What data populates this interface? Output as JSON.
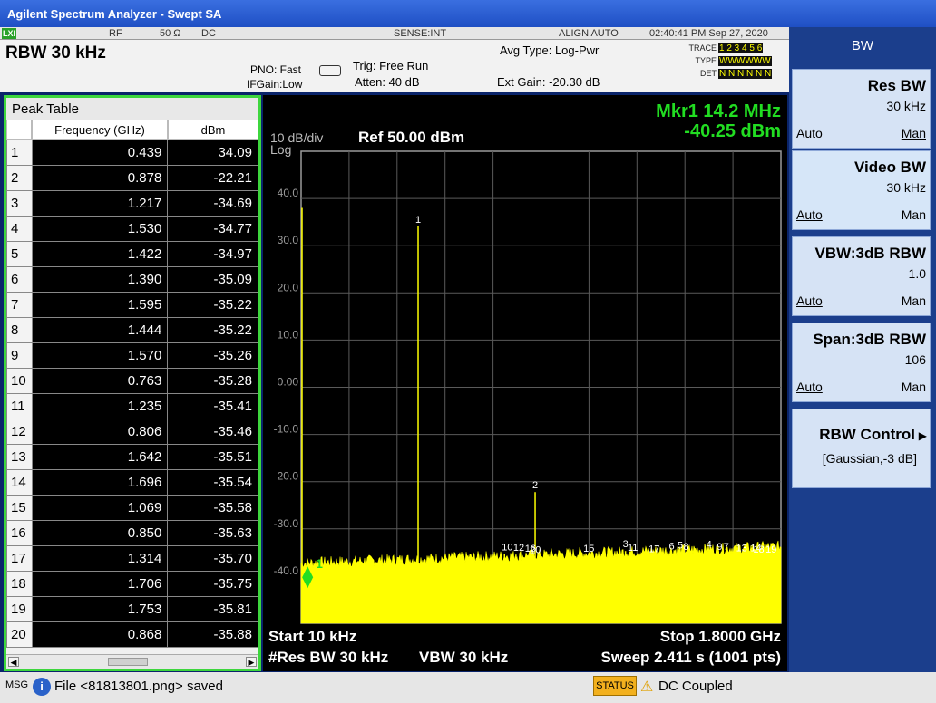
{
  "window": {
    "title": "Agilent Spectrum Analyzer - Swept SA"
  },
  "meas_bar": {
    "logo": "LXI",
    "rf": "RF",
    "impedance": "50 Ω",
    "coupling": "DC",
    "sense": "SENSE:INT",
    "align": "ALIGN AUTO",
    "datetime": "02:40:41 PM Sep 27, 2020",
    "rbw": "RBW 30 kHz",
    "pno": "PNO: Fast",
    "ifgain": "IFGain:Low",
    "trig": "Trig: Free Run",
    "atten": "Atten: 40 dB",
    "avg_type": "Avg Type: Log-Pwr",
    "ext_gain": "Ext Gain: -20.30 dB",
    "trace_label": "TRACE",
    "trace_value": "1 2 3 4 5 6",
    "type_label": "TYPE",
    "type_value": "WWWWWW",
    "det_label": "DET",
    "det_value": "N N N N N N"
  },
  "peak_table": {
    "title": "Peak Table",
    "col_freq": "Frequency (GHz)",
    "col_dbm": "dBm",
    "rows": [
      {
        "n": "1",
        "f": "0.439",
        "d": "34.09"
      },
      {
        "n": "2",
        "f": "0.878",
        "d": "-22.21"
      },
      {
        "n": "3",
        "f": "1.217",
        "d": "-34.69"
      },
      {
        "n": "4",
        "f": "1.530",
        "d": "-34.77"
      },
      {
        "n": "5",
        "f": "1.422",
        "d": "-34.97"
      },
      {
        "n": "6",
        "f": "1.390",
        "d": "-35.09"
      },
      {
        "n": "7",
        "f": "1.595",
        "d": "-35.22"
      },
      {
        "n": "8",
        "f": "1.444",
        "d": "-35.22"
      },
      {
        "n": "9",
        "f": "1.570",
        "d": "-35.26"
      },
      {
        "n": "10",
        "f": "0.763",
        "d": "-35.28"
      },
      {
        "n": "11",
        "f": "1.235",
        "d": "-35.41"
      },
      {
        "n": "12",
        "f": "0.806",
        "d": "-35.46"
      },
      {
        "n": "13",
        "f": "1.642",
        "d": "-35.51"
      },
      {
        "n": "14",
        "f": "1.696",
        "d": "-35.54"
      },
      {
        "n": "15",
        "f": "1.069",
        "d": "-35.58"
      },
      {
        "n": "16",
        "f": "0.850",
        "d": "-35.63"
      },
      {
        "n": "17",
        "f": "1.314",
        "d": "-35.70"
      },
      {
        "n": "18",
        "f": "1.706",
        "d": "-35.75"
      },
      {
        "n": "19",
        "f": "1.753",
        "d": "-35.81"
      },
      {
        "n": "20",
        "f": "0.868",
        "d": "-35.88"
      }
    ]
  },
  "display": {
    "scale": "10 dB/div",
    "scale_type": "Log",
    "ref": "Ref 50.00 dBm",
    "marker_freq": "Mkr1 14.2 MHz",
    "marker_amp": "-40.25 dBm",
    "start": "Start 10 kHz",
    "stop": "Stop 1.8000 GHz",
    "res_bw": "#Res BW 30 kHz",
    "vbw": "VBW 30 kHz",
    "sweep": "Sweep  2.411 s (1001 pts)",
    "y_ticks": [
      "40.0",
      "30.0",
      "20.0",
      "10.0",
      "0.00",
      "-10.0",
      "-20.0",
      "-30.0",
      "-40.0"
    ],
    "trace_color": "#ffff00",
    "marker_color": "#22dd22"
  },
  "chart_data": {
    "type": "line",
    "ylim": [
      -50,
      50
    ],
    "xlim_ghz": [
      1e-05,
      1.8
    ],
    "noise_floor_dbm": -40,
    "markers": [
      {
        "n": "1",
        "x": 0.0142,
        "y": -40.25
      },
      {
        "n": "1",
        "x": 0.439,
        "y": 34.09
      },
      {
        "n": "2",
        "x": 0.878,
        "y": -22.21
      },
      {
        "n": "3",
        "x": 1.217,
        "y": -34.69
      },
      {
        "n": "4",
        "x": 1.53,
        "y": -34.77
      },
      {
        "n": "5",
        "x": 1.422,
        "y": -34.97
      },
      {
        "n": "6",
        "x": 1.39,
        "y": -35.09
      },
      {
        "n": "7",
        "x": 1.595,
        "y": -35.22
      },
      {
        "n": "8",
        "x": 1.444,
        "y": -35.22
      },
      {
        "n": "9",
        "x": 1.57,
        "y": -35.26
      },
      {
        "n": "10",
        "x": 0.763,
        "y": -35.28
      },
      {
        "n": "11",
        "x": 1.235,
        "y": -35.41
      },
      {
        "n": "12",
        "x": 0.806,
        "y": -35.46
      },
      {
        "n": "13",
        "x": 1.642,
        "y": -35.51
      },
      {
        "n": "14",
        "x": 1.696,
        "y": -35.54
      },
      {
        "n": "15",
        "x": 1.069,
        "y": -35.58
      },
      {
        "n": "16",
        "x": 0.85,
        "y": -35.63
      },
      {
        "n": "17",
        "x": 1.314,
        "y": -35.7
      },
      {
        "n": "18",
        "x": 1.706,
        "y": -35.75
      },
      {
        "n": "19",
        "x": 1.753,
        "y": -35.81
      },
      {
        "n": "20",
        "x": 0.868,
        "y": -35.88
      }
    ]
  },
  "softkeys": {
    "menu_title": "BW",
    "res_bw": {
      "title": "Res BW",
      "value": "30 kHz",
      "auto": "Auto",
      "man": "Man"
    },
    "video_bw": {
      "title": "Video BW",
      "value": "30 kHz",
      "auto": "Auto",
      "man": "Man"
    },
    "vbw_rbw": {
      "title": "VBW:3dB RBW",
      "value": "1.0",
      "auto": "Auto",
      "man": "Man"
    },
    "span_rbw": {
      "title": "Span:3dB RBW",
      "value": "106",
      "auto": "Auto",
      "man": "Man"
    },
    "rbw_control": {
      "title": "RBW Control",
      "value": "[Gaussian,-3 dB]"
    }
  },
  "status": {
    "msg": "MSG",
    "text": "File <81813801.png> saved",
    "status_button": "STATUS",
    "coupling_msg": "DC Coupled"
  }
}
